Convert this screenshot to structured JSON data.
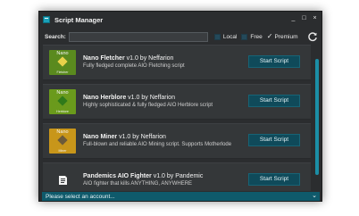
{
  "window": {
    "title": "Script Manager",
    "controls": {
      "minimize": "_",
      "maximize": "□",
      "close": "×"
    }
  },
  "search": {
    "label": "Search:",
    "value": "",
    "placeholder": ""
  },
  "filters": [
    {
      "label": "Local",
      "checked": false
    },
    {
      "label": "Free",
      "checked": false
    },
    {
      "label": "Premium",
      "checked": true
    }
  ],
  "scripts": [
    {
      "name": "Nano Fletcher",
      "version_author": " v1.0 by Neffarion",
      "description": "Fully fledged complete AIO Fletching script",
      "thumb_title": "Nano",
      "thumb_sub": "Fletcher",
      "thumb_color": "#5a8a1e",
      "button": "Start Script"
    },
    {
      "name": "Nano Herblore",
      "version_author": " v1.0 by Neffarion",
      "description": "Highly sophisticated & fully fledged AIO Herblore script",
      "thumb_title": "Nano",
      "thumb_sub": "Herblore",
      "thumb_color": "#6a9a1c",
      "button": "Start Script"
    },
    {
      "name": "Nano Miner",
      "version_author": " v1.0 by Neffarion",
      "description": "Full-blown and reliable AIO Mining script. Supports Motherlode",
      "thumb_title": "Nano",
      "thumb_sub": "Miner",
      "thumb_color": "#c8961a",
      "button": "Start Script"
    },
    {
      "name": "Pandemics AIO Fighter",
      "version_author": " v1.0 by Pandemic",
      "description": "AIO fighter that kills ANYTHING, ANYWHERE",
      "thumb_title": "",
      "thumb_sub": "",
      "thumb_color": "#343739",
      "button": "Start Script"
    }
  ],
  "footer": {
    "account_select": "Please select an account..."
  },
  "icons": {
    "refresh": "refresh-icon",
    "dropdown": "chevron-down-icon",
    "app": "script-manager-icon"
  },
  "colors": {
    "accent": "#1b8ea6",
    "background": "#2b2d2f",
    "button": "#0f4a5a"
  }
}
